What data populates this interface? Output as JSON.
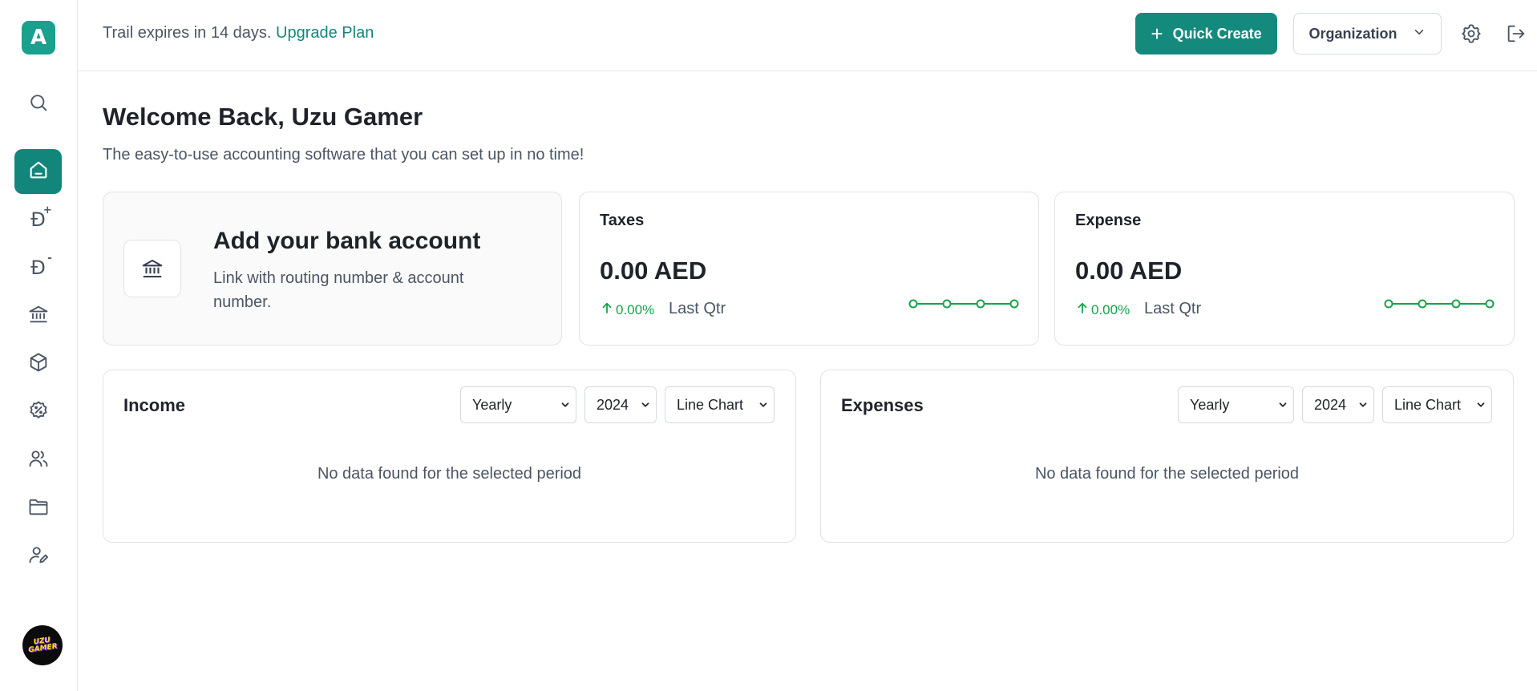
{
  "sidebar": {
    "logo_letter": "A",
    "currency_symbol": "Đ",
    "plus_mark": "+",
    "minus_mark": "-",
    "avatar_text": "UZU GAMER",
    "items": [
      {
        "name": "search",
        "icon": "search-icon"
      },
      {
        "name": "home",
        "icon": "home-icon",
        "active": true
      },
      {
        "name": "income",
        "icon": "dirham-plus-icon"
      },
      {
        "name": "expense",
        "icon": "dirham-minus-icon"
      },
      {
        "name": "banking",
        "icon": "bank-icon"
      },
      {
        "name": "products",
        "icon": "box-icon"
      },
      {
        "name": "taxes",
        "icon": "percent-badge-icon"
      },
      {
        "name": "contacts",
        "icon": "users-icon"
      },
      {
        "name": "documents",
        "icon": "folder-icon"
      },
      {
        "name": "user-edit",
        "icon": "user-edit-icon"
      }
    ]
  },
  "topbar": {
    "trial_text": "Trail expires in 14 days.",
    "upgrade_label": "Upgrade Plan",
    "quick_create_label": "Quick Create",
    "organization_label": "Organization",
    "settings_icon": "gear-icon",
    "logout_icon": "logout-icon"
  },
  "main": {
    "welcome": "Welcome Back, Uzu Gamer",
    "subtitle": "The easy-to-use accounting software that you can set up in no time!",
    "bank_card": {
      "title": "Add your bank account",
      "description": "Link with routing number & account number."
    },
    "stats": [
      {
        "title": "Taxes",
        "amount": "0.00 AED",
        "change": "0.00%",
        "period": "Last Qtr",
        "sparkline": [
          0,
          0,
          0,
          0
        ]
      },
      {
        "title": "Expense",
        "amount": "0.00 AED",
        "change": "0.00%",
        "period": "Last Qtr",
        "sparkline": [
          0,
          0,
          0,
          0
        ]
      }
    ],
    "charts": [
      {
        "title": "Income",
        "frequency": "Yearly",
        "year": "2024",
        "chart_type": "Line Chart",
        "empty_text": "No data found for the selected period"
      },
      {
        "title": "Expenses",
        "frequency": "Yearly",
        "year": "2024",
        "chart_type": "Line Chart",
        "empty_text": "No data found for the selected period"
      }
    ]
  },
  "colors": {
    "brand": "#148a7d",
    "positive": "#16a34a",
    "border": "#dfe3e7"
  }
}
